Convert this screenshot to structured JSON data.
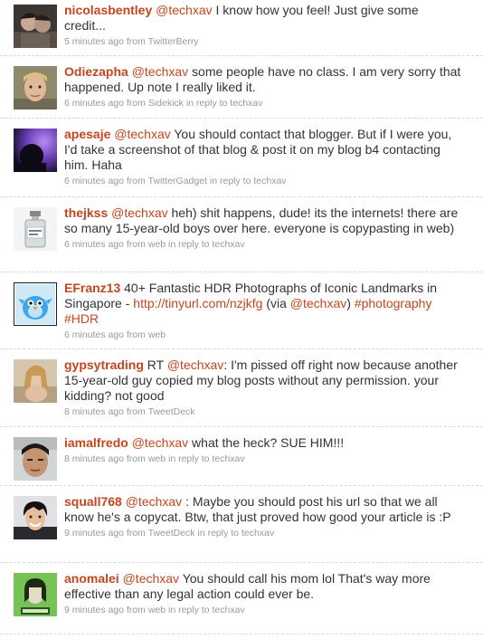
{
  "colors": {
    "link": "#c4461f",
    "text": "#333333",
    "meta": "#999999",
    "divider": "#d2dada"
  },
  "tweets": [
    {
      "user": "nicolasbentley",
      "avatar_icon": "user-photo-couple-icon",
      "segments": [
        {
          "t": " "
        },
        {
          "t": "@techxav",
          "link": true
        },
        {
          "t": " I know how you feel! Just give some credit..."
        }
      ],
      "time": "5 minutes ago",
      "from_label": "from",
      "source": "TwitterBerry",
      "reply_label": "",
      "reply_to": ""
    },
    {
      "user": "Odiezapha",
      "avatar_icon": "user-photo-face-icon",
      "segments": [
        {
          "t": " "
        },
        {
          "t": "@techxav",
          "link": true
        },
        {
          "t": " some people have no class. I am very sorry that happened. Up note I really liked it."
        }
      ],
      "time": "6 minutes ago",
      "from_label": "from",
      "source": "Sidekick",
      "reply_label": "in reply to",
      "reply_to": "techxav"
    },
    {
      "user": "apesaje",
      "avatar_icon": "user-photo-purple-silhouette-icon",
      "segments": [
        {
          "t": " "
        },
        {
          "t": "@techxav",
          "link": true
        },
        {
          "t": " You should contact that blogger. But if I were you, I'd take a screenshot of that blog & post it on my blog b4 contacting him. Haha"
        }
      ],
      "time": "6 minutes ago",
      "from_label": "from",
      "source": "TwitterGadget",
      "reply_label": "in reply to",
      "reply_to": "techxav"
    },
    {
      "user": "thejkss",
      "avatar_icon": "user-photo-bottle-icon",
      "segments": [
        {
          "t": " "
        },
        {
          "t": "@techxav",
          "link": true
        },
        {
          "t": " heh) shit happens, dude! its the internets! there are so many 15-year-old boys over here. everyone is copypasting in web)"
        }
      ],
      "time": "6 minutes ago",
      "from_label": "from",
      "source": "web",
      "reply_label": "in reply to",
      "reply_to": "techxav"
    },
    {
      "user": "EFranz13",
      "avatar_icon": "user-photo-blue-bird-icon",
      "segments": [
        {
          "t": " 40+ Fantastic HDR Photographs of Iconic Landmarks in Singapore - "
        },
        {
          "t": "http://tinyurl.com/nzjkfg",
          "link": true
        },
        {
          "t": " (via "
        },
        {
          "t": "@techxav",
          "link": true
        },
        {
          "t": ") "
        },
        {
          "t": "#photography",
          "link": true
        },
        {
          "t": " "
        },
        {
          "t": "#HDR",
          "link": true
        }
      ],
      "time": "6 minutes ago",
      "from_label": "from",
      "source": "web",
      "reply_label": "",
      "reply_to": ""
    },
    {
      "user": "gypsytrading",
      "avatar_icon": "user-photo-woman-icon",
      "segments": [
        {
          "t": " RT "
        },
        {
          "t": "@techxav",
          "link": true
        },
        {
          "t": ": I'm pissed off right now because another 15-year-old guy copied my blog posts without any permission. your kidding? not good"
        }
      ],
      "time": "8 minutes ago",
      "from_label": "from",
      "source": "TweetDeck",
      "reply_label": "",
      "reply_to": ""
    },
    {
      "user": "iamalfredo",
      "avatar_icon": "user-photo-man-icon",
      "segments": [
        {
          "t": " "
        },
        {
          "t": "@techxav",
          "link": true
        },
        {
          "t": " what the heck? SUE HIM!!!"
        }
      ],
      "time": "8 minutes ago",
      "from_label": "from",
      "source": "web",
      "reply_label": "in reply to",
      "reply_to": "techxav"
    },
    {
      "user": "squall768",
      "avatar_icon": "user-photo-smiling-man-icon",
      "segments": [
        {
          "t": " "
        },
        {
          "t": "@techxav",
          "link": true
        },
        {
          "t": " : Maybe you should post his url so that we all know he's a copycat. Btw, that just proved how good your article is :P"
        }
      ],
      "time": "9 minutes ago",
      "from_label": "from",
      "source": "TweetDeck",
      "reply_label": "in reply to",
      "reply_to": "techxav"
    },
    {
      "user": "anomalei",
      "avatar_icon": "user-photo-green-portrait-icon",
      "segments": [
        {
          "t": " "
        },
        {
          "t": "@techxav",
          "link": true
        },
        {
          "t": " You should call his mom lol That's way more effective than any legal action could ever be."
        }
      ],
      "time": "9 minutes ago",
      "from_label": "from",
      "source": "web",
      "reply_label": "in reply to",
      "reply_to": "techxav"
    }
  ]
}
